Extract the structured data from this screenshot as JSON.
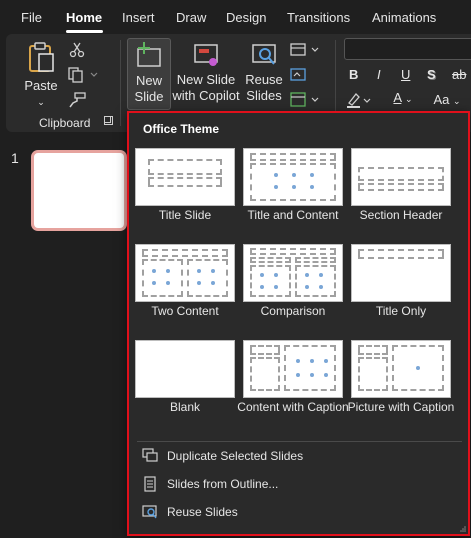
{
  "menubar": {
    "tabs": [
      {
        "label": "File"
      },
      {
        "label": "Home"
      },
      {
        "label": "Insert"
      },
      {
        "label": "Draw"
      },
      {
        "label": "Design"
      },
      {
        "label": "Transitions"
      },
      {
        "label": "Animations"
      }
    ],
    "active_tab": "Home"
  },
  "ribbon": {
    "paste_label": "Paste",
    "clipboard_group": "Clipboard",
    "new_slide_line1": "New",
    "new_slide_line2": "Slide",
    "copilot_line1": "New Slide",
    "copilot_line2": "with Copilot",
    "reuse_line1": "Reuse",
    "reuse_line2": "Slides",
    "bold": "B",
    "italic": "I",
    "underline": "U",
    "shadow": "S",
    "strike": "ab",
    "font_color": "A",
    "case": "Aa"
  },
  "slides_pane": {
    "slide_number": "1"
  },
  "dropdown": {
    "title": "Office Theme",
    "layouts": [
      {
        "name": "Title Slide"
      },
      {
        "name": "Title and Content"
      },
      {
        "name": "Section Header"
      },
      {
        "name": "Two Content"
      },
      {
        "name": "Comparison"
      },
      {
        "name": "Title Only"
      },
      {
        "name": "Blank"
      },
      {
        "name": "Content with Caption"
      },
      {
        "name": "Picture with Caption"
      }
    ],
    "actions": [
      {
        "label": "Duplicate Selected Slides",
        "icon": "duplicate-slides-icon"
      },
      {
        "label": "Slides from Outline...",
        "icon": "outline-document-icon"
      },
      {
        "label": "Reuse Slides",
        "icon": "reuse-slides-icon"
      }
    ],
    "highlight_color": "#e0101b"
  }
}
